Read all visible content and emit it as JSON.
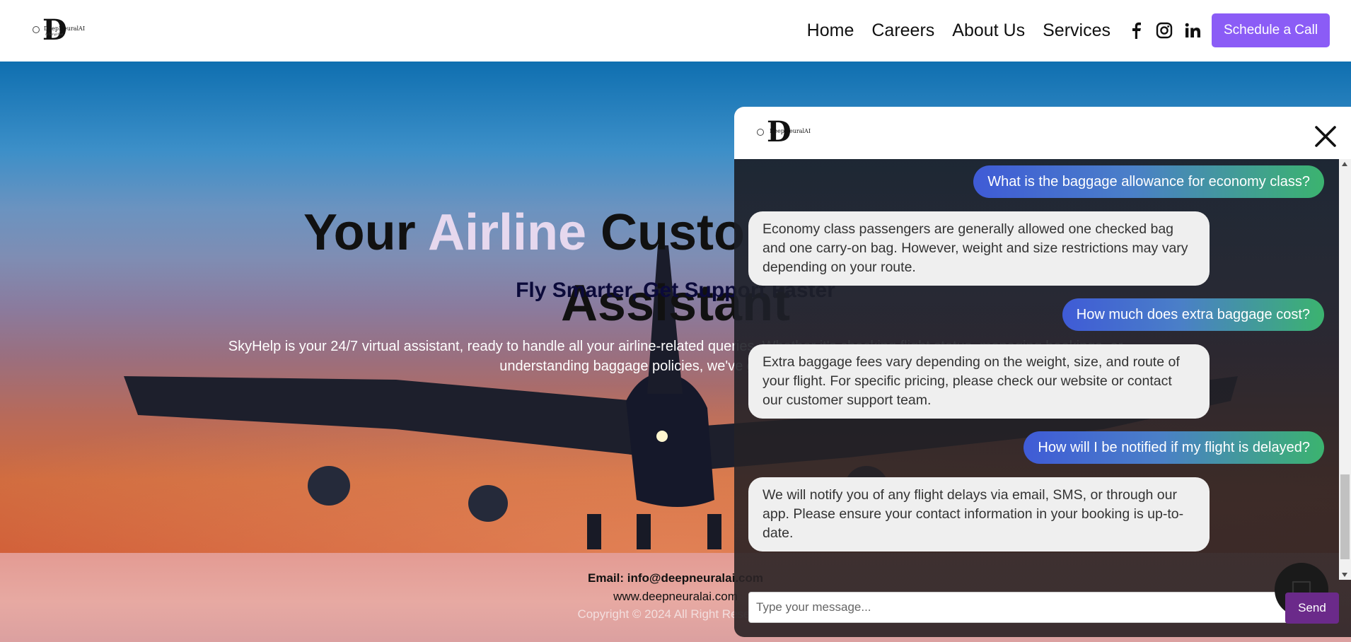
{
  "header": {
    "logo_name": "DeepNeuralAI",
    "logo_tagline": "AI Simplified",
    "nav": [
      "Home",
      "Careers",
      "About Us",
      "Services"
    ],
    "social_icons": [
      "facebook-icon",
      "instagram-icon",
      "linkedin-icon"
    ],
    "cta_label": "Schedule a Call"
  },
  "hero": {
    "title_part1": "Your ",
    "title_highlight": "Airline",
    "title_part2": " Customer Support",
    "title_line2": "Assistant",
    "subtitle": "Fly Smarter, Get Support Faster",
    "description": "SkyHelp is your 24/7 virtual assistant, ready to handle all your airline-related queries. Whether it's checking flight status, managing bookings, or understanding baggage policies, we've got you covered."
  },
  "footer": {
    "email": "Email: info@deepneuralai.com",
    "website": "www.deepneuralai.com",
    "copyright": "Copyright © 2024 All Right Reserved"
  },
  "chat": {
    "messages": [
      {
        "role": "user",
        "text": "What is the baggage allowance for economy class?"
      },
      {
        "role": "bot",
        "text": "Economy class passengers are generally allowed one checked bag and one carry-on bag. However, weight and size restrictions may vary depending on your route."
      },
      {
        "role": "user",
        "text": "How much does extra baggage cost?"
      },
      {
        "role": "bot",
        "text": "Extra baggage fees vary depending on the weight, size, and route of your flight. For specific pricing, please check our website or contact our customer support team."
      },
      {
        "role": "user",
        "text": "How will I be notified if my flight is delayed?"
      },
      {
        "role": "bot",
        "text": "We will notify you of any flight delays via email, SMS, or through our app. Please ensure your contact information in your booking is up-to-date."
      }
    ],
    "input_placeholder": "Type your message...",
    "send_label": "Send"
  },
  "colors": {
    "cta": "#8b5cf6",
    "user_bubble_start": "#3f5bd6",
    "user_bubble_end": "#3bb36f",
    "bot_bubble": "#efefef",
    "send_button": "#6b2a8a"
  }
}
